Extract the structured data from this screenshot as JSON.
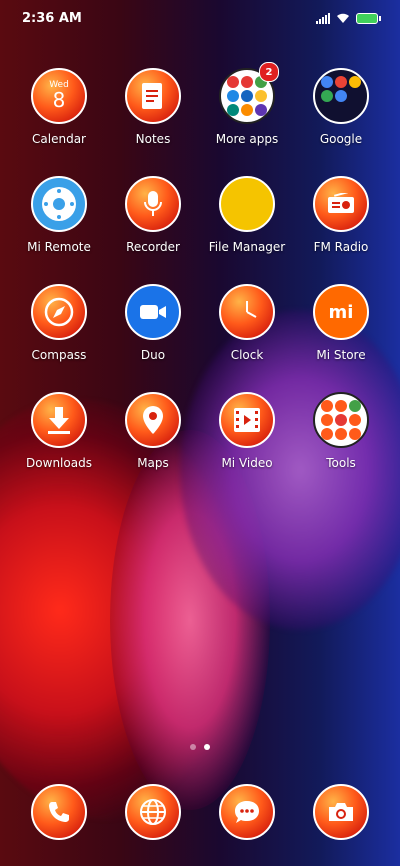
{
  "status_bar": {
    "time": "2:36 AM"
  },
  "apps": [
    {
      "label": "Calendar",
      "icon": "calendar-icon",
      "day_name": "Wed",
      "day_number": "8"
    },
    {
      "label": "Notes",
      "icon": "notes-icon"
    },
    {
      "label": "More apps",
      "icon": "folder-icon",
      "badge": "2"
    },
    {
      "label": "Google",
      "icon": "folder-icon"
    },
    {
      "label": "Mi Remote",
      "icon": "remote-icon"
    },
    {
      "label": "Recorder",
      "icon": "microphone-icon"
    },
    {
      "label": "File Manager",
      "icon": "file-manager-icon"
    },
    {
      "label": "FM Radio",
      "icon": "radio-icon"
    },
    {
      "label": "Compass",
      "icon": "compass-icon"
    },
    {
      "label": "Duo",
      "icon": "video-camera-icon"
    },
    {
      "label": "Clock",
      "icon": "clock-icon"
    },
    {
      "label": "Mi Store",
      "icon": "mi-store-icon",
      "brand": "mi"
    },
    {
      "label": "Downloads",
      "icon": "download-icon"
    },
    {
      "label": "Maps",
      "icon": "map-pin-icon"
    },
    {
      "label": "Mi Video",
      "icon": "film-icon"
    },
    {
      "label": "Tools",
      "icon": "folder-icon"
    }
  ],
  "dock": [
    {
      "icon": "phone-icon"
    },
    {
      "icon": "globe-icon"
    },
    {
      "icon": "message-icon"
    },
    {
      "icon": "camera-icon"
    }
  ],
  "page_indicator": {
    "pages": 2,
    "active": 2
  },
  "colors": {
    "icon_orange": "#ff5a1a",
    "badge_red": "#e02020",
    "duo_blue": "#1a73e8",
    "mi_orange": "#ff6900",
    "file_yellow": "#f5c400",
    "remote_blue": "#3aa0e8"
  }
}
